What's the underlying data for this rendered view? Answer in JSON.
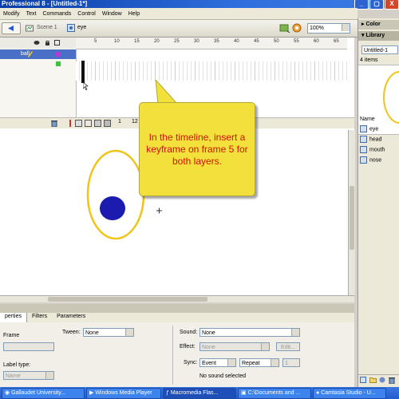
{
  "window": {
    "title": "Professional 8 - [Untitled-1*]",
    "buttons": [
      "_",
      "▢",
      "X"
    ]
  },
  "menu": [
    "Modify",
    "Text",
    "Commands",
    "Control",
    "Window",
    "Help"
  ],
  "stage_header": {
    "scene": "Scene 1",
    "symbol": "eye",
    "zoom": "100%"
  },
  "timeline": {
    "frame_numbers": [
      "5",
      "10",
      "15",
      "20",
      "25",
      "30",
      "35",
      "40",
      "45",
      "50",
      "55",
      "60",
      "65"
    ],
    "layers": [
      {
        "name": "ball",
        "selected": true
      },
      {
        "name": "",
        "selected": false
      }
    ],
    "status_frame": "1",
    "status_fps": "12"
  },
  "callout": {
    "text": "In the timeline, insert a keyframe on frame 5 for both layers."
  },
  "properties": {
    "tabs": [
      "perties",
      "Filters",
      "Parameters"
    ],
    "frame_label": "Frame",
    "tween_label": "Tween:",
    "tween_value": "None",
    "label_type_label": "Label type:",
    "label_type_value": "Name",
    "sound_label": "Sound:",
    "sound_value": "None",
    "effect_label": "Effect:",
    "effect_value": "None",
    "edit_label": "Edit...",
    "sync_label": "Sync:",
    "sync_value": "Event",
    "repeat_value": "Repeat",
    "repeat_count": "1",
    "sound_status": "No sound selected"
  },
  "right_panel": {
    "color_header": "Color",
    "library_header": "Library",
    "library_doc": "Untitled-1",
    "items_count": "4 items",
    "name_col": "Name",
    "items": [
      "eye",
      "head",
      "mouth",
      "nose"
    ]
  },
  "taskbar": [
    "Gallaudet University...",
    "Windows Media Player",
    "Macromedia Flas...",
    "C:\\Documents and ...",
    "Camtasia Studio - U..."
  ],
  "colors": {
    "callout_bg": "#f2e13b",
    "callout_text": "#d60f0f",
    "ellipse_stroke": "#f0c419",
    "ball_fill": "#1b1bb0"
  }
}
